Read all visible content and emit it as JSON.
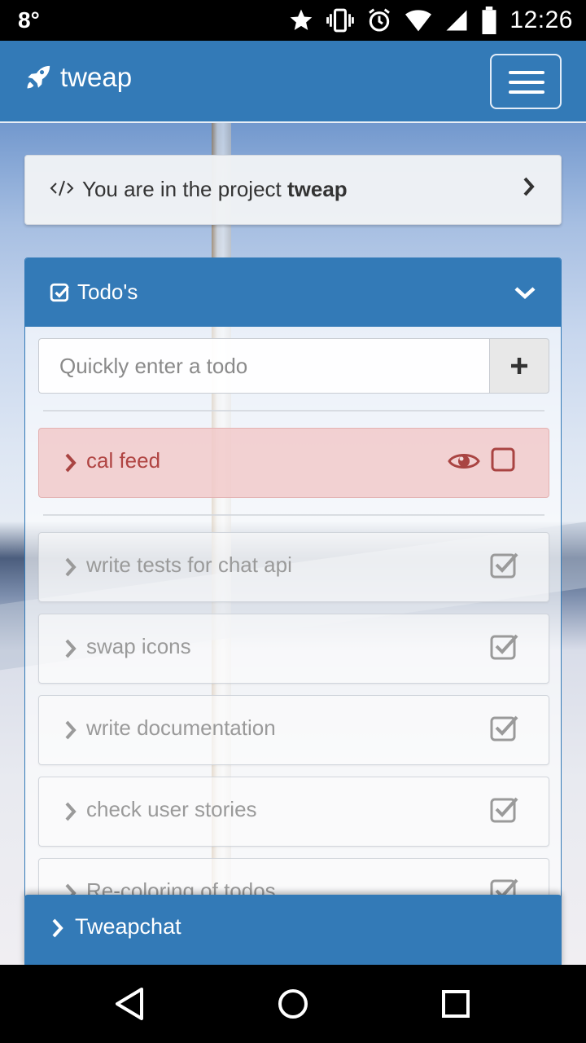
{
  "status_bar": {
    "temperature": "8°",
    "time": "12:26",
    "icons": [
      "star-icon",
      "vibrate-icon",
      "alarm-icon",
      "wifi-icon",
      "signal-icon",
      "battery-icon"
    ]
  },
  "navbar": {
    "brand": "tweap",
    "brand_icon": "rocket-icon",
    "menu_icon": "hamburger-menu-icon"
  },
  "project": {
    "prefix": "You are in the project",
    "name": "tweap",
    "icon": "code-icon"
  },
  "todos": {
    "title": "Todo's",
    "input_placeholder": "Quickly enter a todo",
    "add_label": "+",
    "items": [
      {
        "label": "cal feed",
        "status": "open",
        "watched": true
      },
      {
        "label": "write tests for chat api",
        "status": "done"
      },
      {
        "label": "swap icons",
        "status": "done"
      },
      {
        "label": "write documentation",
        "status": "done"
      },
      {
        "label": "check user stories",
        "status": "done"
      },
      {
        "label": "Re-coloring of todos",
        "status": "done"
      }
    ]
  },
  "chat": {
    "label": "Tweapchat"
  },
  "colors": {
    "primary": "#337ab7",
    "open_todo_bg": "#f2dede",
    "open_todo_text": "#a94442"
  },
  "system_nav": [
    "back-icon",
    "home-icon",
    "recents-icon"
  ]
}
